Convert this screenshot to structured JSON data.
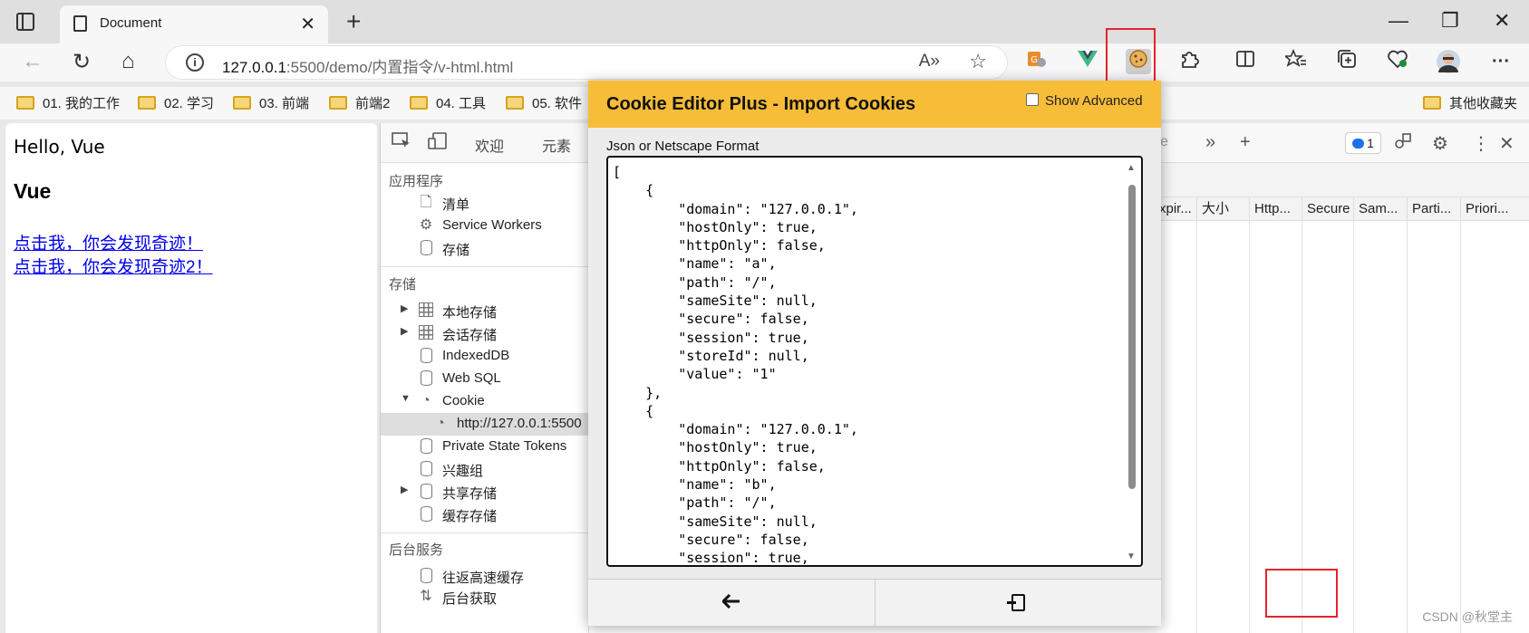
{
  "tabbar": {
    "tab_title": "Document",
    "close_glyph": "✕",
    "new_tab_glyph": "+"
  },
  "window_controls": {
    "minimize": "—",
    "restore": "❐",
    "close": "✕"
  },
  "nav": {
    "back": "←",
    "reload": "↻",
    "home": "⌂",
    "url_host": "127.0.0.1",
    "url_rest": ":5500/demo/内置指令/v-html.html",
    "read_aloud": "A»",
    "favorite": "☆"
  },
  "extensions": {
    "more": "···"
  },
  "bookmarks": [
    "01. 我的工作",
    "02. 学习",
    "03. 前端",
    "前端2",
    "04. 工具",
    "05. 软件"
  ],
  "bookmarks_other": "其他收藏夹",
  "page": {
    "hello": "Hello, Vue",
    "heading": "Vue",
    "link1": "点击我，你会发现奇迹！",
    "link2": "点击我，你会发现奇迹2！"
  },
  "devtools": {
    "tabs": [
      "欢迎",
      "元素"
    ],
    "partial_tab": "e",
    "issues_count": "1",
    "sections": {
      "app": "应用程序",
      "storage": "存储",
      "background": "后台服务"
    },
    "app_items": [
      "清单",
      "Service Workers",
      "存储"
    ],
    "storage_items": [
      "本地存储",
      "会话存储",
      "IndexedDB",
      "Web SQL",
      "Cookie",
      "http://127.0.0.1:5500",
      "Private State Tokens",
      "兴趣组",
      "共享存储",
      "缓存存储"
    ],
    "background_items": [
      "往返高速缓存",
      "后台获取"
    ],
    "columns": [
      "xpir...",
      "大小",
      "Http...",
      "Secure",
      "Sam...",
      "Parti...",
      "Priori..."
    ]
  },
  "popup": {
    "title": "Cookie Editor Plus - Import Cookies",
    "show_advanced": "Show Advanced",
    "format_label": "Json or Netscape Format",
    "json_text": "[\n    {\n        \"domain\": \"127.0.0.1\",\n        \"hostOnly\": true,\n        \"httpOnly\": false,\n        \"name\": \"a\",\n        \"path\": \"/\",\n        \"sameSite\": null,\n        \"secure\": false,\n        \"session\": true,\n        \"storeId\": null,\n        \"value\": \"1\"\n    },\n    {\n        \"domain\": \"127.0.0.1\",\n        \"hostOnly\": true,\n        \"httpOnly\": false,\n        \"name\": \"b\",\n        \"path\": \"/\",\n        \"sameSite\": null,\n        \"secure\": false,\n        \"session\": true,",
    "back_glyph": "🡐"
  },
  "watermark": "CSDN @秋堂主",
  "colors": {
    "accent": "#f8bd38",
    "highlight": "#e4232b",
    "link": "#0000ee"
  }
}
